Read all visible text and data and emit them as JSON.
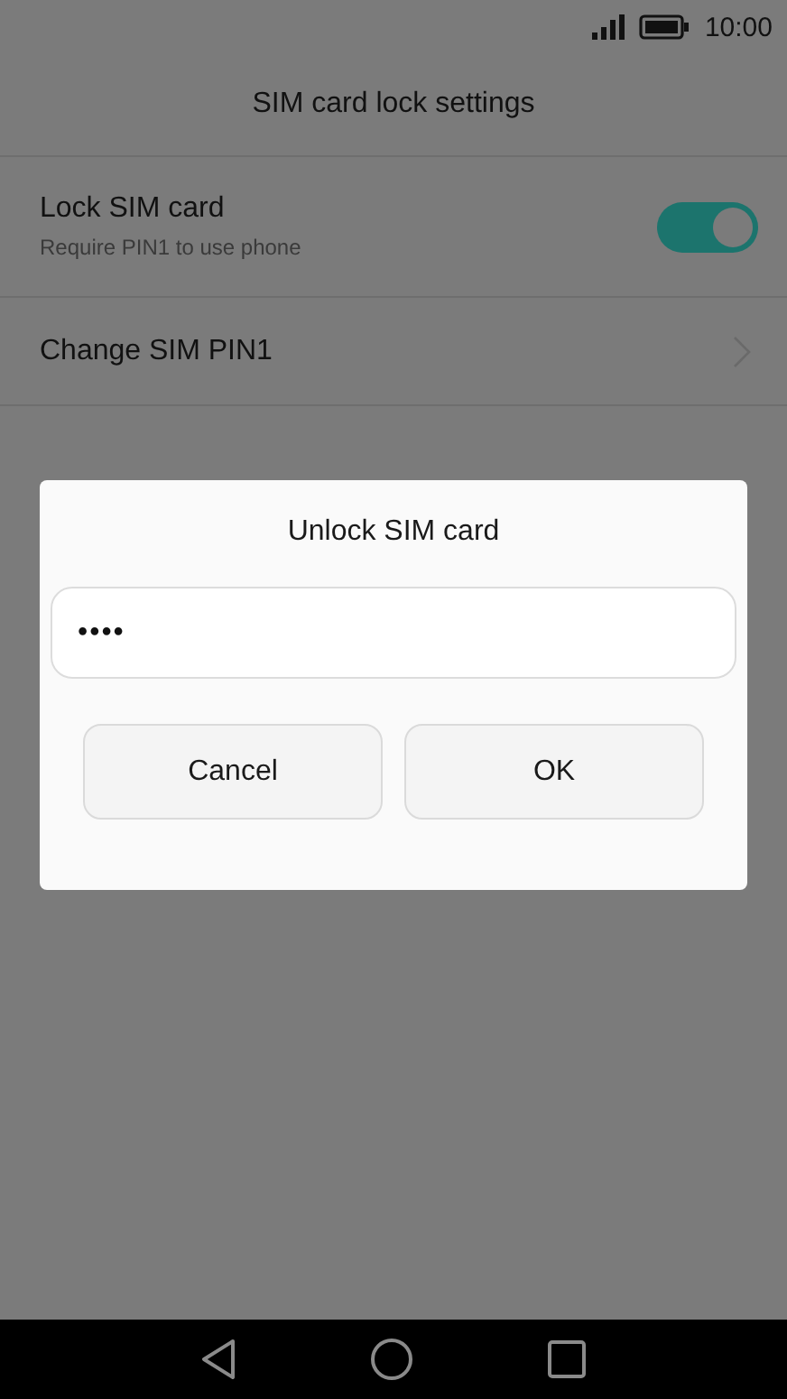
{
  "status_bar": {
    "time": "10:00"
  },
  "header": {
    "title": "SIM card lock settings"
  },
  "settings": [
    {
      "kind": "toggle",
      "label": "Lock SIM card",
      "sublabel": "Require PIN1 to use phone",
      "on": true
    },
    {
      "kind": "link",
      "label": "Change SIM PIN1"
    }
  ],
  "dialog": {
    "title": "Unlock SIM card",
    "field": {
      "value": "••••"
    },
    "buttons": [
      "Cancel",
      "OK"
    ]
  }
}
